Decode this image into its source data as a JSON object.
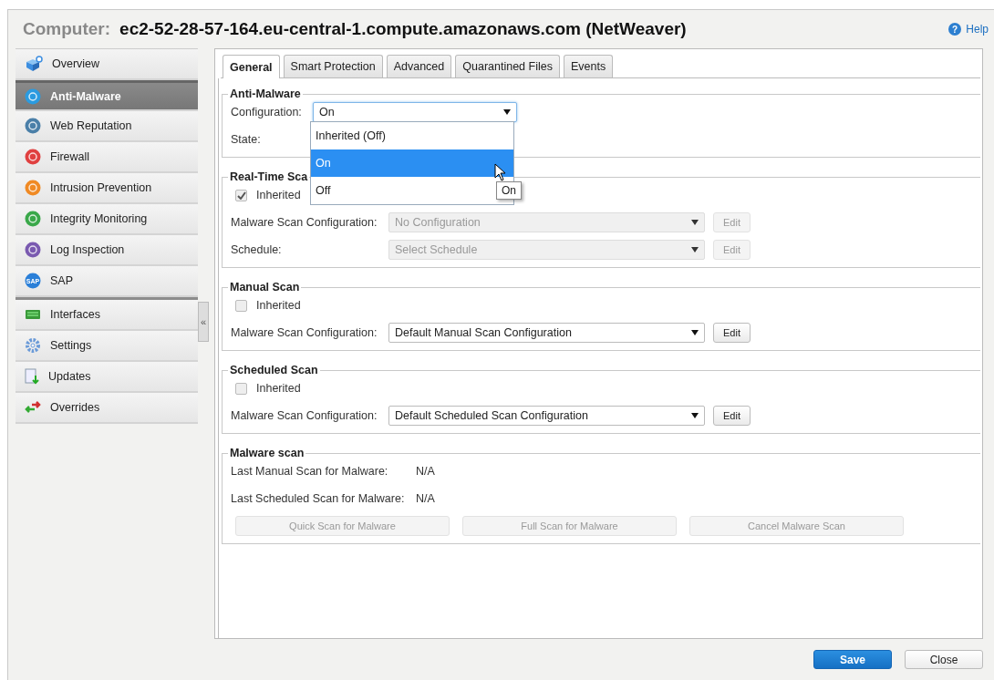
{
  "header": {
    "label": "Computer:",
    "host": "ec2-52-28-57-164.eu-central-1.compute.amazonaws.com (NetWeaver)",
    "help": "Help",
    "help_glyph": "?"
  },
  "sidebar": {
    "groups": [
      [
        {
          "label": "Overview",
          "kind": "cube",
          "selected": false
        },
        {
          "label": "Anti-Malware",
          "kind": "shield",
          "selected": true
        },
        {
          "label": "Web Reputation",
          "kind": "web",
          "selected": false
        },
        {
          "label": "Firewall",
          "kind": "wall",
          "selected": false
        },
        {
          "label": "Intrusion Prevention",
          "kind": "ips",
          "selected": false
        },
        {
          "label": "Integrity Monitoring",
          "kind": "print",
          "selected": false
        },
        {
          "label": "Log Inspection",
          "kind": "magnifier",
          "selected": false
        },
        {
          "label": "SAP",
          "kind": "sap",
          "icon_text": "SAP",
          "selected": false
        }
      ],
      [
        {
          "label": "Interfaces",
          "kind": "card",
          "selected": false
        },
        {
          "label": "Settings",
          "kind": "gear",
          "selected": false
        },
        {
          "label": "Updates",
          "kind": "doc",
          "selected": false
        },
        {
          "label": "Overrides",
          "kind": "arrows",
          "selected": false
        }
      ]
    ]
  },
  "splitter": {
    "glyph": "«"
  },
  "tabs": [
    {
      "label": "General",
      "selected": true
    },
    {
      "label": "Smart Protection",
      "selected": false
    },
    {
      "label": "Advanced",
      "selected": false
    },
    {
      "label": "Quarantined Files",
      "selected": false
    },
    {
      "label": "Events",
      "selected": false
    }
  ],
  "sections": [
    {
      "kind": "config",
      "title": "Anti-Malware",
      "configuration": {
        "label": "Configuration:",
        "value": "On",
        "expanded": true,
        "options": [
          {
            "label": "Inherited (Off)",
            "selected": false
          },
          {
            "label": "On",
            "selected": true
          },
          {
            "label": "Off",
            "selected": false
          }
        ]
      },
      "state": {
        "label": "State:"
      },
      "tooltip": "On"
    },
    {
      "kind": "scan",
      "title": "Real-Time Sca",
      "inherited": {
        "label": "Inherited",
        "checked": true
      },
      "rows": [
        {
          "label": "Malware Scan Configuration:",
          "value": "No Configuration",
          "disabled": true,
          "button": "Edit"
        },
        {
          "label": "Schedule:",
          "value": "Select Schedule",
          "disabled": true,
          "button": "Edit"
        }
      ]
    },
    {
      "kind": "scan",
      "title": "Manual Scan",
      "inherited": {
        "label": "Inherited",
        "checked": false
      },
      "rows": [
        {
          "label": "Malware Scan Configuration:",
          "value": "Default Manual Scan Configuration",
          "disabled": false,
          "button": "Edit"
        }
      ]
    },
    {
      "kind": "scan",
      "title": "Scheduled Scan",
      "inherited": {
        "label": "Inherited",
        "checked": false
      },
      "rows": [
        {
          "label": "Malware Scan Configuration:",
          "value": "Default Scheduled Scan Configuration",
          "disabled": false,
          "button": "Edit"
        }
      ]
    },
    {
      "kind": "status",
      "title": "Malware scan",
      "rows": [
        {
          "label": "Last Manual Scan for Malware:",
          "value": "N/A"
        },
        {
          "label": "Last Scheduled Scan for Malware:",
          "value": "N/A"
        }
      ],
      "buttons": [
        {
          "label": "Quick Scan for Malware",
          "disabled": true
        },
        {
          "label": "Full Scan for Malware",
          "disabled": true
        },
        {
          "label": "Cancel Malware Scan",
          "disabled": true
        }
      ]
    }
  ],
  "footer": {
    "buttons": [
      {
        "label": "Save",
        "kind": "primary"
      },
      {
        "label": "Close",
        "kind": "secondary"
      }
    ]
  }
}
